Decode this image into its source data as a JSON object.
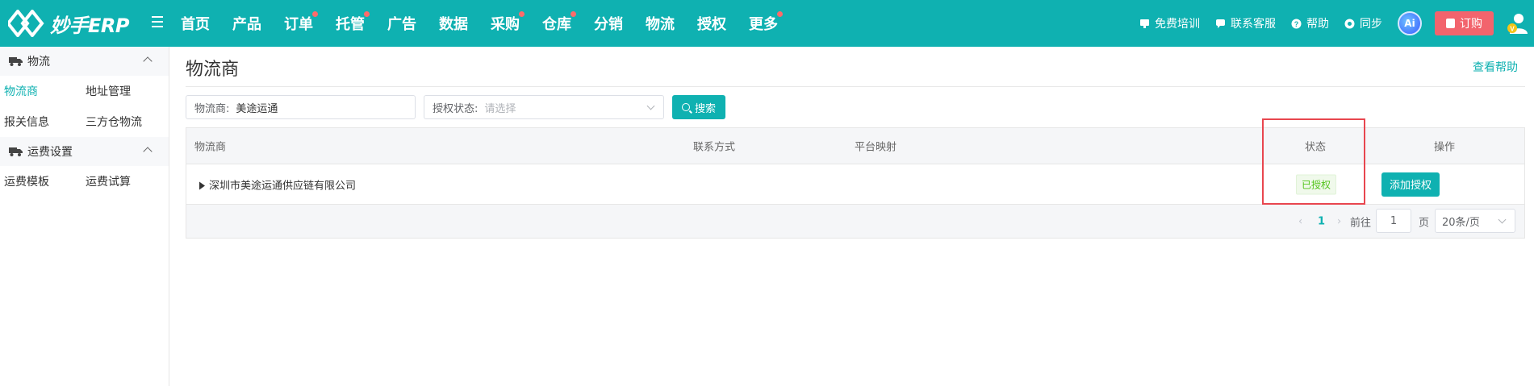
{
  "app": {
    "logo_text": "妙手ERP"
  },
  "nav": [
    {
      "label": "首页",
      "dot": false
    },
    {
      "label": "产品",
      "dot": false
    },
    {
      "label": "订单",
      "dot": true
    },
    {
      "label": "托管",
      "dot": true
    },
    {
      "label": "广告",
      "dot": false
    },
    {
      "label": "数据",
      "dot": false
    },
    {
      "label": "采购",
      "dot": true
    },
    {
      "label": "仓库",
      "dot": true
    },
    {
      "label": "分销",
      "dot": false
    },
    {
      "label": "物流",
      "dot": false
    },
    {
      "label": "授权",
      "dot": false
    },
    {
      "label": "更多",
      "dot": true
    }
  ],
  "tools": {
    "training": "免费培训",
    "support": "联系客服",
    "help": "帮助",
    "sync": "同步",
    "ai": "Ai",
    "order": "订购"
  },
  "sidebar": {
    "group1": {
      "title": "物流",
      "items": [
        "物流商",
        "地址管理",
        "报关信息",
        "三方仓物流"
      ]
    },
    "group2": {
      "title": "运费设置",
      "items": [
        "运费模板",
        "运费试算"
      ]
    }
  },
  "page": {
    "title": "物流商",
    "help_link": "查看帮助"
  },
  "filters": {
    "carrier_label": "物流商:",
    "carrier_value": "美途运通",
    "auth_label": "授权状态:",
    "auth_placeholder": "请选择",
    "search_button": "搜索"
  },
  "table": {
    "columns": [
      "物流商",
      "联系方式",
      "平台映射",
      "状态",
      "操作"
    ],
    "rows": [
      {
        "carrier": "深圳市美途运通供应链有限公司",
        "contact": "",
        "mapping": "",
        "status": "已授权",
        "action": "添加授权"
      }
    ]
  },
  "pagination": {
    "current_page": "1",
    "goto_label": "前往",
    "goto_value": "1",
    "page_unit": "页",
    "page_size": "20条/页"
  },
  "colors": {
    "primary": "#0fb1b1",
    "order_button": "#f2646d",
    "highlight_box": "#e8464f",
    "status_green": "#52c41a"
  }
}
